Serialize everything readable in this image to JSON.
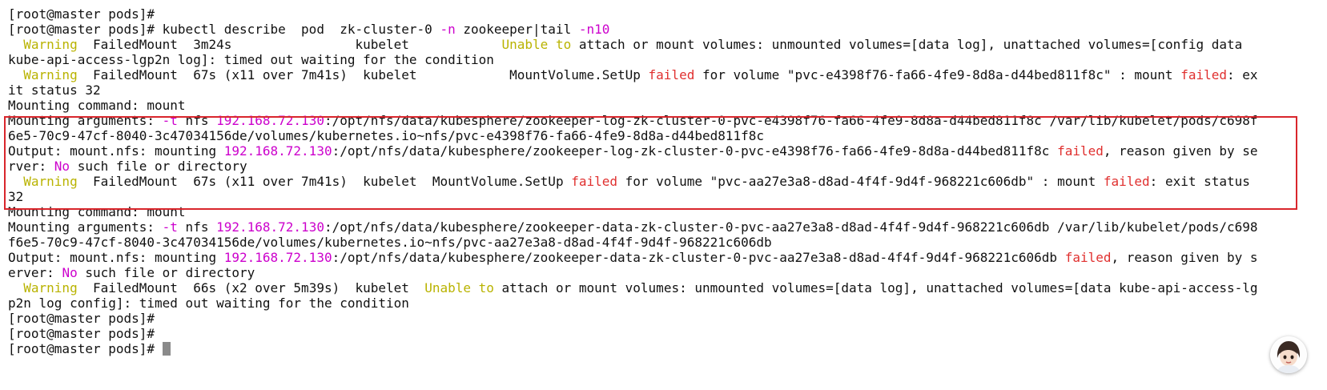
{
  "terminal": {
    "lines": [
      [
        {
          "t": "[root@master pods]#"
        }
      ],
      [
        {
          "t": "[root@master pods]# kubectl describe  pod  zk-cluster-0 "
        },
        {
          "t": "-n",
          "c": "flag"
        },
        {
          "t": " zookeeper|tail "
        },
        {
          "t": "-n10",
          "c": "flag"
        }
      ],
      [
        {
          "t": "  "
        },
        {
          "t": "Warning",
          "c": "warn"
        },
        {
          "t": "  FailedMount  3m24s                kubelet            "
        },
        {
          "t": "Unable to",
          "c": "warn"
        },
        {
          "t": " attach or mount volumes: unmounted volumes=[data log], unattached volumes=[config data"
        }
      ],
      [
        {
          "t": "kube-api-access-lgp2n log]: timed out waiting for the condition"
        }
      ],
      [
        {
          "t": "  "
        },
        {
          "t": "Warning",
          "c": "warn"
        },
        {
          "t": "  FailedMount  67s (x11 over 7m41s)  kubelet            MountVolume.SetUp "
        },
        {
          "t": "failed",
          "c": "fail"
        },
        {
          "t": " for volume \"pvc-e4398f76-fa66-4fe9-8d8a-d44bed811f8c\" : mount "
        },
        {
          "t": "failed",
          "c": "fail"
        },
        {
          "t": ": ex"
        }
      ],
      [
        {
          "t": "it status 32"
        }
      ],
      [
        {
          "t": "Mounting command: mount"
        }
      ],
      [
        {
          "t": "Mounting arguments: "
        },
        {
          "t": "-t",
          "c": "flag"
        },
        {
          "t": " nfs "
        },
        {
          "t": "192.168.72.130",
          "c": "ip"
        },
        {
          "t": ":/opt/nfs/data/kubesphere/zookeeper-log-zk-cluster-0-pvc-e4398f76-fa66-4fe9-8d8a-d44bed811f8c /var/lib/kubelet/pods/c698f"
        }
      ],
      [
        {
          "t": "6e5-70c9-47cf-8040-3c47034156de/volumes/kubernetes.io~nfs/pvc-e4398f76-fa66-4fe9-8d8a-d44bed811f8c"
        }
      ],
      [
        {
          "t": "Output: mount.nfs: mounting "
        },
        {
          "t": "192.168.72.130",
          "c": "ip"
        },
        {
          "t": ":/opt/nfs/data/kubesphere/zookeeper-log-zk-cluster-0-pvc-e4398f76-fa66-4fe9-8d8a-d44bed811f8c "
        },
        {
          "t": "failed",
          "c": "fail"
        },
        {
          "t": ", reason given by se"
        }
      ],
      [
        {
          "t": "rver: "
        },
        {
          "t": "No",
          "c": "no"
        },
        {
          "t": " such file or directory"
        }
      ],
      [
        {
          "t": "  "
        },
        {
          "t": "Warning",
          "c": "warn"
        },
        {
          "t": "  FailedMount  67s (x11 over 7m41s)  kubelet  MountVolume.SetUp "
        },
        {
          "t": "failed",
          "c": "fail"
        },
        {
          "t": " for volume \"pvc-aa27e3a8-d8ad-4f4f-9d4f-968221c606db\" : mount "
        },
        {
          "t": "failed",
          "c": "fail"
        },
        {
          "t": ": exit status"
        }
      ],
      [
        {
          "t": "32"
        }
      ],
      [
        {
          "t": "Mounting command: mount"
        }
      ],
      [
        {
          "t": "Mounting arguments: "
        },
        {
          "t": "-t",
          "c": "flag"
        },
        {
          "t": " nfs "
        },
        {
          "t": "192.168.72.130",
          "c": "ip"
        },
        {
          "t": ":/opt/nfs/data/kubesphere/zookeeper-data-zk-cluster-0-pvc-aa27e3a8-d8ad-4f4f-9d4f-968221c606db /var/lib/kubelet/pods/c698"
        }
      ],
      [
        {
          "t": "f6e5-70c9-47cf-8040-3c47034156de/volumes/kubernetes.io~nfs/pvc-aa27e3a8-d8ad-4f4f-9d4f-968221c606db"
        }
      ],
      [
        {
          "t": "Output: mount.nfs: mounting "
        },
        {
          "t": "192.168.72.130",
          "c": "ip"
        },
        {
          "t": ":/opt/nfs/data/kubesphere/zookeeper-data-zk-cluster-0-pvc-aa27e3a8-d8ad-4f4f-9d4f-968221c606db "
        },
        {
          "t": "failed",
          "c": "fail"
        },
        {
          "t": ", reason given by s"
        }
      ],
      [
        {
          "t": "erver: "
        },
        {
          "t": "No",
          "c": "no"
        },
        {
          "t": " such file or directory"
        }
      ],
      [
        {
          "t": "  "
        },
        {
          "t": "Warning",
          "c": "warn"
        },
        {
          "t": "  FailedMount  66s (x2 over 5m39s)  kubelet  "
        },
        {
          "t": "Unable to",
          "c": "warn"
        },
        {
          "t": " attach or mount volumes: unmounted volumes=[data log], unattached volumes=[data kube-api-access-lg"
        }
      ],
      [
        {
          "t": "p2n log config]: timed out waiting for the condition"
        }
      ],
      [
        {
          "t": "[root@master pods]#"
        }
      ],
      [
        {
          "t": "[root@master pods]#"
        }
      ],
      [
        {
          "t": "[root@master pods]# "
        }
      ]
    ]
  },
  "colors": {
    "flag": "#cc00cc",
    "ip": "#cc00cc",
    "warn": "#b9b300",
    "fail": "#e0302f",
    "highlight_border": "#d9262c"
  },
  "icons": {
    "avatar": "avatar-icon"
  }
}
